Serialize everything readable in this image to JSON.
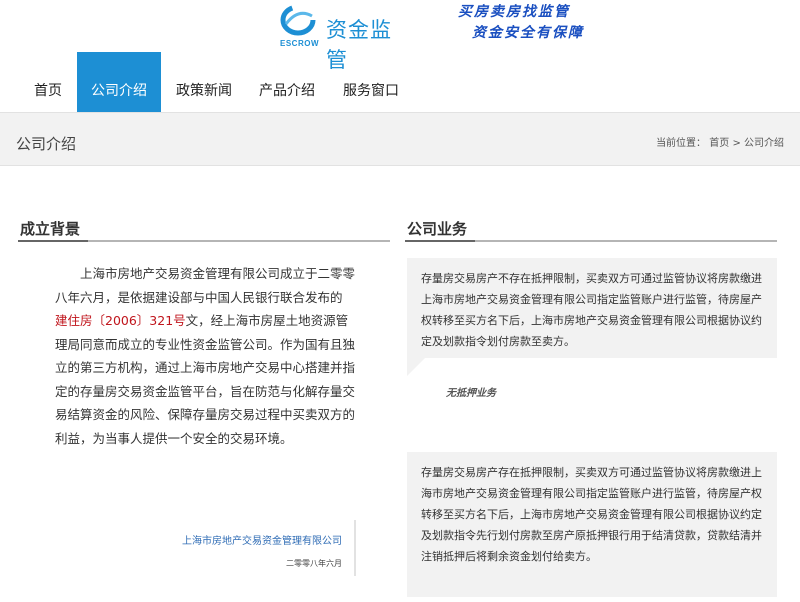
{
  "header": {
    "logo_text": "资金监管",
    "logo_sub": "ESCROW",
    "logo_icon": "swirl-logo-icon",
    "slogan_line1": "买房卖房找监管",
    "slogan_line2": "资金安全有保障"
  },
  "nav": {
    "items": [
      "首页",
      "公司介绍",
      "政策新闻",
      "产品介绍",
      "服务窗口"
    ],
    "active_index": 1
  },
  "banner": {
    "title": "公司介绍",
    "crumb_prefix": "当前位置：",
    "crumb_home": "首页",
    "crumb_sep": " > ",
    "crumb_current": "公司介绍"
  },
  "background": {
    "heading": "成立背景",
    "para_before": "上海市房地产交易资金管理有限公司成立于二零零八年六月，是依据建设部与中国人民银行联合发布的",
    "para_red": "建住房〔2006〕321号",
    "para_after": "文，经上海市房屋土地资源管理局同意而成立的专业性资金监管公司。作为国有且独立的第三方机构，通过上海市房地产交易中心搭建并指定的存量房交易资金监管平台，旨在防范与化解存量交易结算资金的风险、保障存量房交易过程中买卖双方的利益，为当事人提供一个安全的交易环境。",
    "sign_org": "上海市房地产交易资金管理有限公司",
    "sign_date": "二零零八年六月"
  },
  "business": {
    "heading": "公司业务",
    "box1_text": "存量房交易房产不存在抵押限制，买卖双方可通过监管协议将房款缴进上海市房地产交易资金管理有限公司指定监管账户进行监管，待房屋产权转移至买方名下后，上海市房地产交易资金管理有限公司根据协议约定及划款指令划付房款至卖方。",
    "box1_caption": "无抵押业务",
    "box2_text": "存量房交易房产存在抵押限制，买卖双方可通过监管协议将房款缴进上海市房地产交易资金管理有限公司指定监管账户进行监管，待房屋产权转移至买方名下后，上海市房地产交易资金管理有限公司根据协议约定及划款指令先行划付房款至房产原抵押银行用于结清贷款，贷款结清并注销抵押后将剩余资金划付给卖方。"
  },
  "colors": {
    "brand_blue": "#1d8fd4",
    "slogan_blue": "#1a4fc0",
    "doc_red": "#c0151c",
    "panel_gray": "#f2f2f2"
  }
}
